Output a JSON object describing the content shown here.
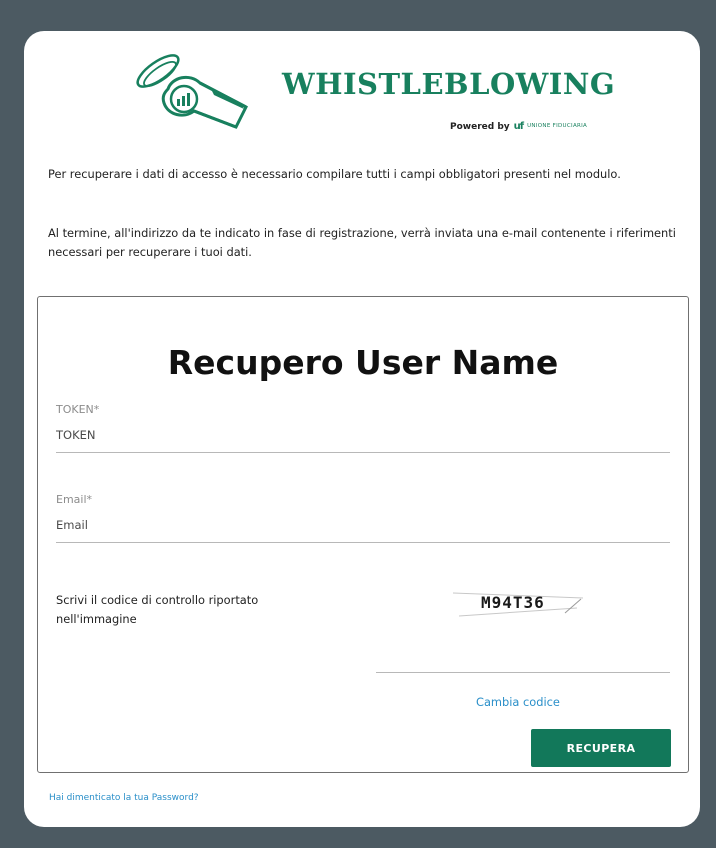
{
  "brand": {
    "name": "WHISTLEBLOWING",
    "powered_by": "Powered by",
    "partner_mark": "uf",
    "partner_name": "UNIONE FIDUCIARIA",
    "logo_icon": "whistle-icon"
  },
  "intro": {
    "paragraph_1": "Per recuperare i dati di accesso è necessario compilare tutti i campi obbligatori presenti nel modulo.",
    "paragraph_2": "Al termine, all'indirizzo da te indicato in fase di registrazione, verrà inviata una e-mail contenente i riferimenti necessari per recuperare i tuoi dati."
  },
  "form": {
    "title": "Recupero User Name",
    "token": {
      "label": "TOKEN*",
      "placeholder": "TOKEN",
      "value": ""
    },
    "email": {
      "label": "Email*",
      "placeholder": "Email",
      "value": ""
    },
    "captcha": {
      "label": "Scrivi il codice di controllo riportato nell'immagine",
      "code": "M94T36",
      "value": ""
    },
    "change_code_label": "Cambia codice",
    "submit_label": "RECUPERA"
  },
  "footer": {
    "forgot_password_label": "Hai dimenticato la tua Password?"
  },
  "colors": {
    "brand_green": "#18805e",
    "button_green": "#12785a",
    "link_blue": "#2a8fc9",
    "page_background": "#4c5a62"
  }
}
